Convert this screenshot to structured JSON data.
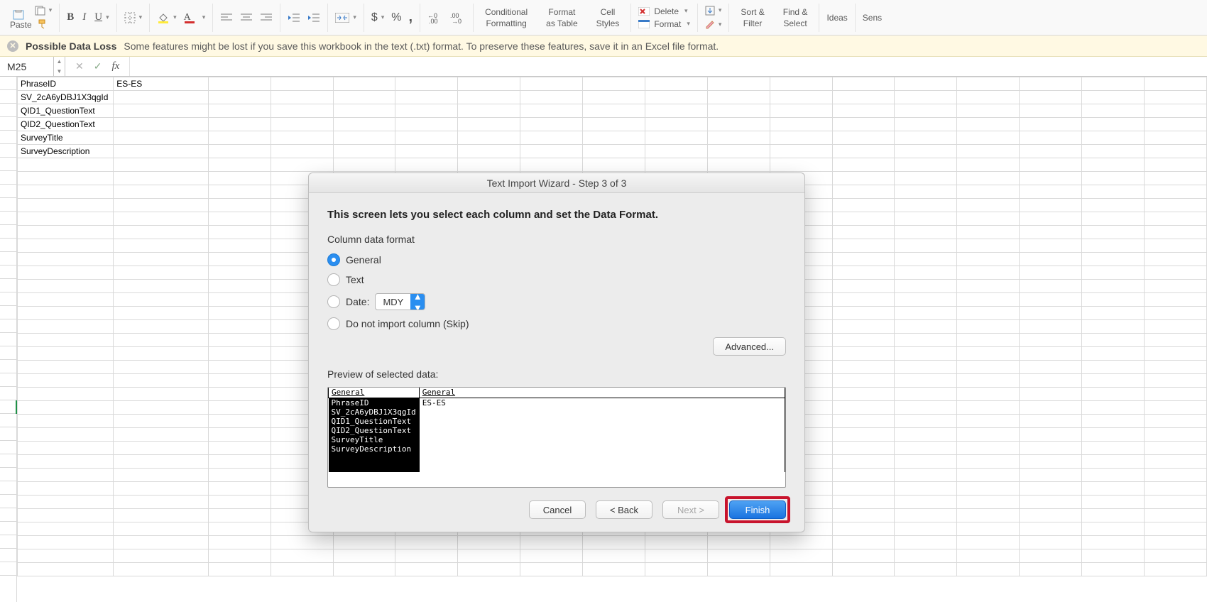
{
  "ribbon": {
    "paste": "Paste",
    "delete": "Delete",
    "format": "Format",
    "conditional_formatting_l1": "Conditional",
    "conditional_formatting_l2": "Formatting",
    "format_as_table_l1": "Format",
    "format_as_table_l2": "as Table",
    "cell_styles_l1": "Cell",
    "cell_styles_l2": "Styles",
    "sort_filter_l1": "Sort &",
    "sort_filter_l2": "Filter",
    "find_select_l1": "Find &",
    "find_select_l2": "Select",
    "ideas": "Ideas",
    "sens": "Sens"
  },
  "warn": {
    "title": "Possible Data Loss",
    "msg": "Some features might be lost if you save this workbook in the text (.txt) format. To preserve these features, save it in an Excel file format."
  },
  "fbar": {
    "name": "M25",
    "fx": "fx",
    "value": ""
  },
  "sheet": {
    "rows": [
      [
        "PhraseID",
        "ES-ES"
      ],
      [
        "SV_2cA6yDBJ1X3qgId",
        ""
      ],
      [
        "QID1_QuestionText",
        ""
      ],
      [
        "QID2_QuestionText",
        ""
      ],
      [
        "SurveyTitle",
        ""
      ],
      [
        "SurveyDescription",
        ""
      ]
    ]
  },
  "dialog": {
    "title": "Text Import Wizard - Step 3 of 3",
    "heading": "This screen lets you select each column and set the Data Format.",
    "section": "Column data format",
    "opt_general": "General",
    "opt_text": "Text",
    "opt_date": "Date:",
    "date_format": "MDY",
    "opt_skip": "Do not import column (Skip)",
    "advanced": "Advanced...",
    "preview_label": "Preview of selected data:",
    "preview_headers": [
      "General",
      "General"
    ],
    "preview_rows": [
      [
        "PhraseID",
        "ES-ES"
      ],
      [
        "SV_2cA6yDBJ1X3qgId",
        ""
      ],
      [
        "QID1_QuestionText",
        ""
      ],
      [
        "QID2_QuestionText",
        ""
      ],
      [
        "SurveyTitle",
        ""
      ],
      [
        "SurveyDescription",
        ""
      ]
    ],
    "btn_cancel": "Cancel",
    "btn_back": "< Back",
    "btn_next": "Next >",
    "btn_finish": "Finish"
  }
}
